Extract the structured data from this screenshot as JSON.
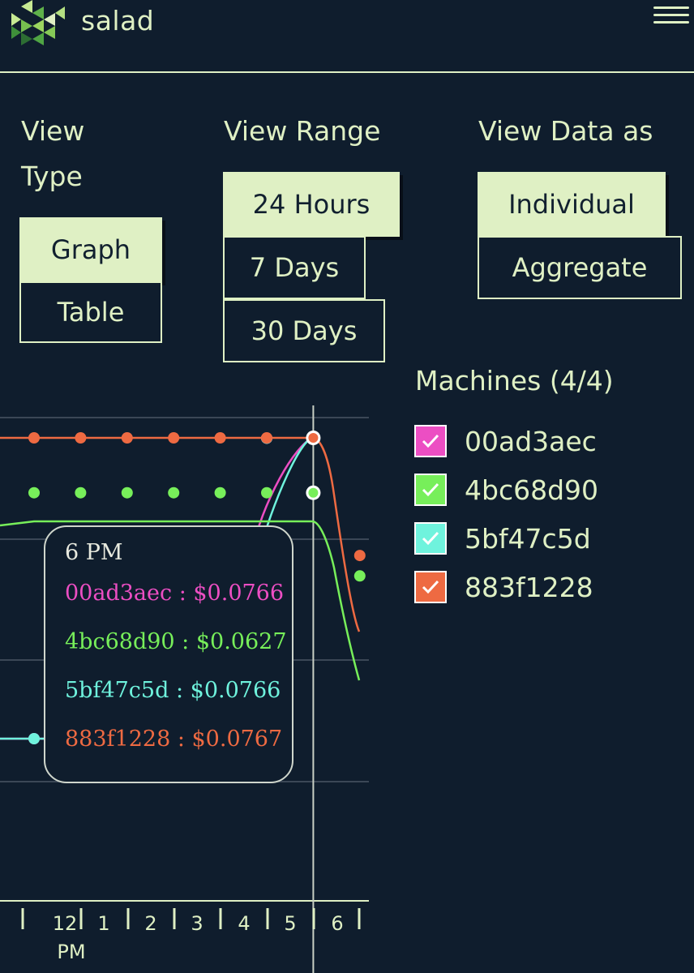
{
  "header": {
    "brand": "salad",
    "logo_icon": "salad-logo-icon",
    "menu_icon": "hamburger-menu-icon"
  },
  "controls": {
    "view_type": {
      "label_line1": "View",
      "label_line2": "Type",
      "options": [
        "Graph",
        "Table"
      ],
      "selected": "Graph"
    },
    "view_range": {
      "label": "View Range",
      "options": [
        "24 Hours",
        "7 Days",
        "30 Days"
      ],
      "selected": "24 Hours"
    },
    "view_data_as": {
      "label": "View Data as",
      "options": [
        "Individual",
        "Aggregate"
      ],
      "selected": "Individual"
    }
  },
  "legend": {
    "title": "Machines (4/4)",
    "items": [
      {
        "id": "00ad3aec",
        "color": "#ec4ec3",
        "checked": true
      },
      {
        "id": "4bc68d90",
        "color": "#77ef5a",
        "checked": true
      },
      {
        "id": "5bf47c5d",
        "color": "#6ff3dd",
        "checked": true
      },
      {
        "id": "883f1228",
        "color": "#ee6a42",
        "checked": true
      }
    ]
  },
  "tooltip": {
    "time": "6 PM",
    "rows": [
      {
        "machine": "00ad3aec",
        "value": "$0.0766",
        "color": "#ec4ec3",
        "text": "00ad3aec : $0.0766"
      },
      {
        "machine": "4bc68d90",
        "value": "$0.0627",
        "color": "#77ef5a",
        "text": "4bc68d90 : $0.0627"
      },
      {
        "machine": "5bf47c5d",
        "value": "$0.0766",
        "color": "#6ff3dd",
        "text": "5bf47c5d : $0.0766"
      },
      {
        "machine": "883f1228",
        "value": "$0.0767",
        "color": "#ee6a42",
        "text": "883f1228 : $0.0767"
      }
    ]
  },
  "chart_data": {
    "type": "line",
    "x_ticks": [
      "12",
      "1",
      "2",
      "3",
      "4",
      "5",
      "6"
    ],
    "x_tick_sub": "PM",
    "x": [
      11.5,
      12,
      13,
      14,
      15,
      16,
      17,
      18,
      19
    ],
    "ylim": [
      0,
      0.08
    ],
    "grid": true,
    "series": [
      {
        "name": "00ad3aec",
        "color": "#ec4ec3",
        "values": [
          0,
          0,
          0,
          0,
          0,
          0,
          0.0766,
          null,
          null
        ]
      },
      {
        "name": "4bc68d90",
        "color": "#77ef5a",
        "values": [
          null,
          0.0627,
          0.0627,
          0.0627,
          0.0627,
          0.0627,
          0.0627,
          0.0627,
          0.0415
        ]
      },
      {
        "name": "5bf47c5d",
        "color": "#6ff3dd",
        "values": [
          0,
          0,
          0,
          0,
          0,
          0,
          0.0766,
          null,
          null
        ]
      },
      {
        "name": "883f1228",
        "color": "#ee6a42",
        "values": [
          0.0767,
          0.0767,
          0.0767,
          0.0767,
          0.0767,
          0.0767,
          0.0767,
          0.0767,
          0.0467
        ]
      }
    ],
    "hover_x": 18
  }
}
